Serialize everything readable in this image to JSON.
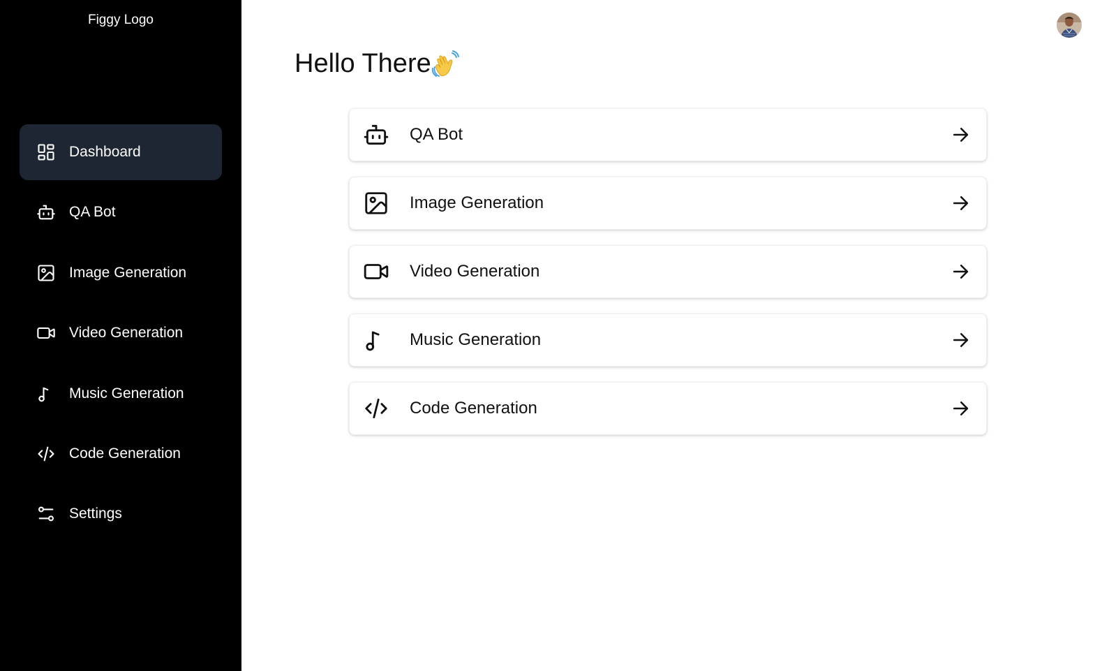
{
  "sidebar": {
    "logo": "Figgy Logo",
    "items": [
      {
        "label": "Dashboard",
        "icon": "dashboard-icon",
        "active": true
      },
      {
        "label": "QA Bot",
        "icon": "bot-icon"
      },
      {
        "label": "Image Generation",
        "icon": "image-icon"
      },
      {
        "label": "Video Generation",
        "icon": "video-icon"
      },
      {
        "label": "Music Generation",
        "icon": "music-icon"
      },
      {
        "label": "Code Generation",
        "icon": "code-icon"
      },
      {
        "label": "Settings",
        "icon": "settings-sliders-icon"
      }
    ]
  },
  "header": {
    "avatar": "user-avatar"
  },
  "main": {
    "greeting": "Hello There",
    "greeting_emoji": "waving-hand-icon",
    "cards": [
      {
        "label": "QA Bot",
        "icon": "bot-icon"
      },
      {
        "label": "Image Generation",
        "icon": "image-icon"
      },
      {
        "label": "Video Generation",
        "icon": "video-icon"
      },
      {
        "label": "Music Generation",
        "icon": "music-icon"
      },
      {
        "label": "Code Generation",
        "icon": "code-icon"
      }
    ]
  },
  "colors": {
    "sidebar_bg": "#000000",
    "active_item_bg": "#1e2633",
    "text_dark": "#111111",
    "text_light": "#ffffff"
  }
}
